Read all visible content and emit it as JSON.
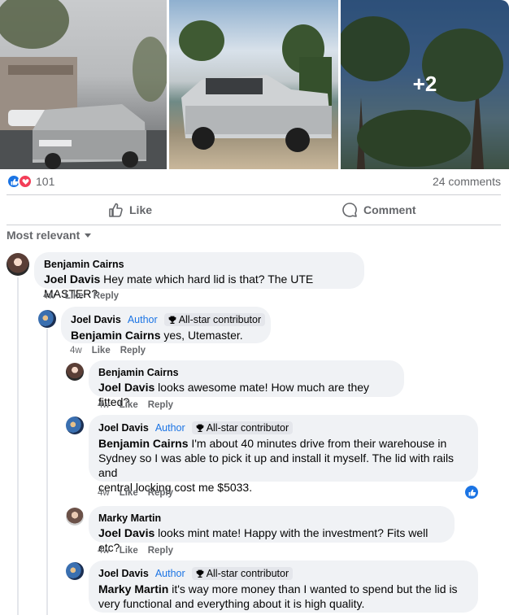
{
  "photos": {
    "more_count": "+2"
  },
  "reactions": {
    "count": "101",
    "comments": "24 comments"
  },
  "actions": {
    "like": "Like",
    "comment": "Comment"
  },
  "sort": {
    "label": "Most relevant"
  },
  "comments": [
    {
      "author": "Benjamin Cairns",
      "tag": "Joel Davis",
      "text": " Hey mate which hard lid is that? The UTE MASTER?",
      "time": "4w",
      "like": "Like",
      "reply": "Reply"
    },
    {
      "author": "Joel Davis",
      "author_badge": "Author",
      "contrib": "All-star contributor",
      "tag": "Benjamin Cairns",
      "text": " yes, Utemaster.",
      "time": "4w",
      "like": "Like",
      "reply": "Reply"
    },
    {
      "author": "Benjamin Cairns",
      "tag": "Joel Davis",
      "text": " looks awesome mate! How much are they fitted?",
      "time": "4w",
      "like": "Like",
      "reply": "Reply"
    },
    {
      "author": "Joel Davis",
      "author_badge": "Author",
      "contrib": "All-star contributor",
      "tag": "Benjamin Cairns",
      "line1": " I'm about 40 minutes drive from their warehouse in",
      "line2": "Sydney so I was able to pick it up and install it myself. The lid with rails and",
      "line3": "central locking cost me $5033.",
      "time": "4w",
      "like": "Like",
      "reply": "Reply"
    },
    {
      "author": "Marky Martin",
      "tag": "Joel Davis",
      "text": " looks mint mate! Happy with the investment? Fits well etc?",
      "time": "4w",
      "like": "Like",
      "reply": "Reply"
    },
    {
      "author": "Joel Davis",
      "author_badge": "Author",
      "contrib": "All-star contributor",
      "tag": "Marky Martin",
      "line1": " it's way more money than I wanted to spend but the lid is",
      "line2": "very functional and everything about it is high quality."
    }
  ],
  "colors": {
    "accent": "#1b74e4",
    "love": "#f33e58",
    "bubble": "#f0f2f5",
    "muted": "#65676b"
  }
}
